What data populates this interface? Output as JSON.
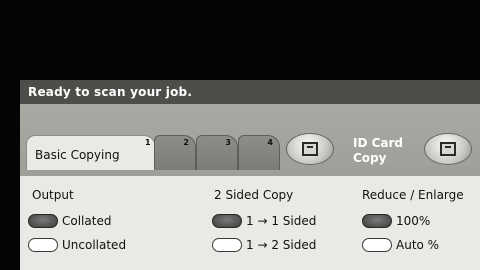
{
  "status": {
    "message": "Ready to scan your job."
  },
  "tabs": [
    {
      "label": "Basic Copying",
      "number": "1"
    },
    {
      "label": "",
      "number": "2"
    },
    {
      "label": "",
      "number": "3"
    },
    {
      "label": "",
      "number": "4"
    }
  ],
  "id_card_copy": {
    "line1": "ID Card",
    "line2": "Copy"
  },
  "output": {
    "heading": "Output",
    "options": [
      "Collated",
      "Uncollated"
    ],
    "selected": "Collated"
  },
  "two_sided": {
    "heading": "2 Sided Copy",
    "options": [
      "1 → 1 Sided",
      "1 → 2 Sided"
    ],
    "selected": "1 → 1 Sided"
  },
  "reduce_enlarge": {
    "heading": "Reduce / Enlarge",
    "options": [
      "100%",
      "Auto %"
    ],
    "selected": "100%"
  },
  "icons": {
    "document": "document-icon",
    "id_card": "id-card-icon"
  },
  "colors": {
    "status_bar": "#4e4d49",
    "panel": "#e9e9e6",
    "selected_pill": "#3d3d3b"
  }
}
